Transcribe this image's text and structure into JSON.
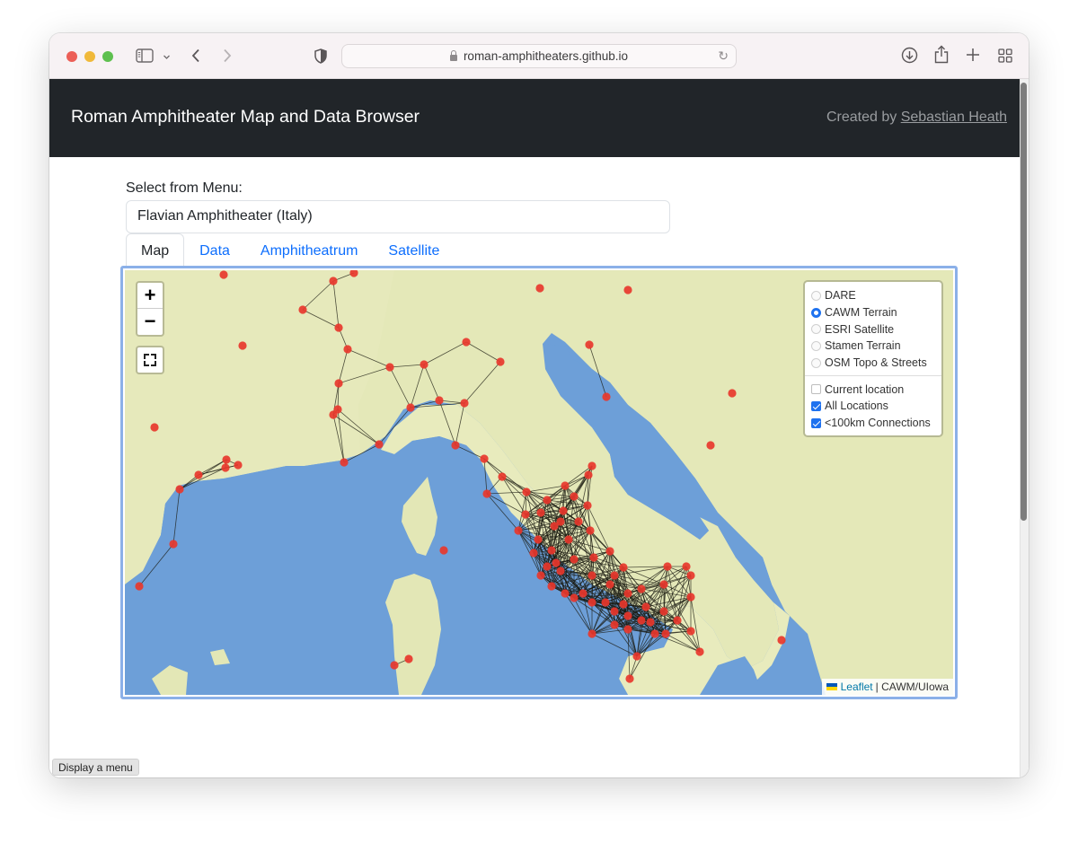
{
  "browser": {
    "url": "roman-amphitheaters.github.io",
    "icons": [
      "sidebar-icon",
      "chevron-down-icon",
      "back-icon",
      "forward-icon",
      "privacy-shield-icon",
      "lock-icon",
      "reload-icon",
      "download-icon",
      "share-icon",
      "new-tab-icon",
      "tab-overview-icon"
    ]
  },
  "navbar": {
    "brand": "Roman Amphitheater Map and Data Browser",
    "credit_prefix": "Created by",
    "credit_link": "Sebastian Heath"
  },
  "form": {
    "label": "Select from Menu:",
    "selected": "Flavian Amphitheater (Italy)"
  },
  "tabs": [
    {
      "label": "Map",
      "active": true
    },
    {
      "label": "Data",
      "active": false
    },
    {
      "label": "Amphitheatrum",
      "active": false
    },
    {
      "label": "Satellite",
      "active": false
    }
  ],
  "map": {
    "zoom_in": "+",
    "zoom_out": "−",
    "base_layers": [
      {
        "label": "DARE",
        "selected": false
      },
      {
        "label": "CAWM Terrain",
        "selected": true
      },
      {
        "label": "ESRI Satellite",
        "selected": false
      },
      {
        "label": "Stamen Terrain",
        "selected": false
      },
      {
        "label": "OSM Topo & Streets",
        "selected": false
      }
    ],
    "overlays": [
      {
        "label": "Current location",
        "checked": false
      },
      {
        "label": "All Locations",
        "checked": true
      },
      {
        "label": "<100km Connections",
        "checked": true
      }
    ],
    "attribution_link": "Leaflet",
    "attribution_text": "| CAWM/UIowa",
    "colors": {
      "marker": "#e8372c",
      "water": "#6d9fd8",
      "land": "#e9ecbf",
      "connection": "#1a1a10"
    }
  },
  "status_tooltip": "Display a menu"
}
